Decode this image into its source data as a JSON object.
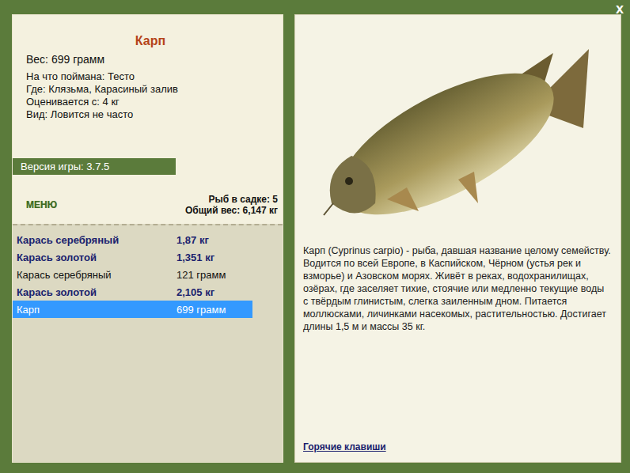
{
  "window": {
    "close": "x"
  },
  "fish": {
    "title": "Карп",
    "weight": "Вес: 699 грамм",
    "details": [
      "На что поймана: Тесто",
      "Где: Клязьма, Карасиный залив",
      "Оценивается с: 4 кг",
      "Вид: Ловится не часто"
    ]
  },
  "version": "Версия игры: 3.7.5",
  "menu": "МЕНЮ",
  "stats": [
    "Рыб в садке: 5",
    "Общий вес: 6,147 кг"
  ],
  "catch": [
    {
      "name": "Карась серебряный",
      "weight": "1,87 кг",
      "trophy": true,
      "selected": false
    },
    {
      "name": "Карась золотой",
      "weight": "1,351 кг",
      "trophy": true,
      "selected": false
    },
    {
      "name": "Карась серебряный",
      "weight": "121 грамм",
      "trophy": false,
      "selected": false
    },
    {
      "name": "Карась золотой",
      "weight": "2,105 кг",
      "trophy": true,
      "selected": false
    },
    {
      "name": "Карп",
      "weight": "699 грамм",
      "trophy": false,
      "selected": true
    }
  ],
  "description": "Карп (Cyprinus carpio) - рыба, давшая название целому семейству. Водится по всей Европе, в Каспийском, Чёрном (устья рек и взморье) и Азовском морях. Живёт в реках, водохранилищах, озёрах, где заселяет тихие, стоячие или медленно текущие воды с твёрдым глинистым, слегка заиленным дном. Питается моллюсками, личинками насекомых, растительностью. Достигает длины 1,5 м и массы 35 кг.",
  "hotkeys": "Горячие клавиши"
}
